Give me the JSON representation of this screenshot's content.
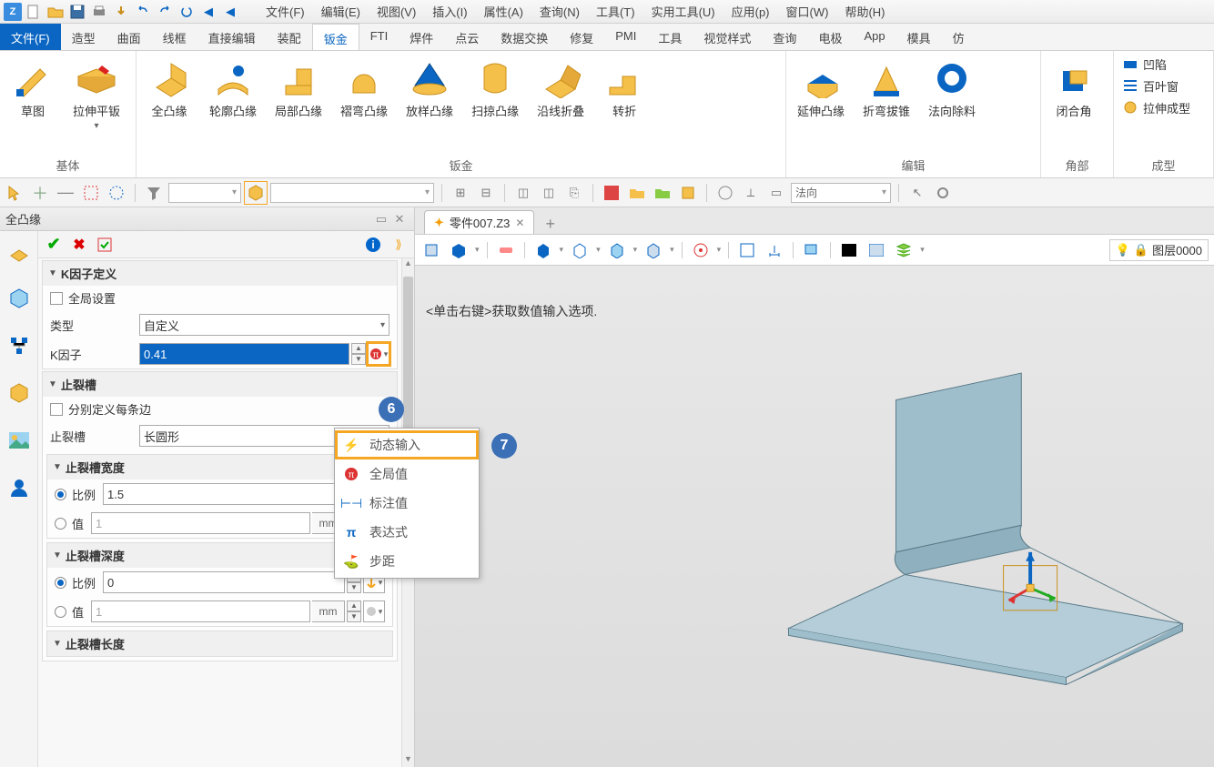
{
  "menus": {
    "file": "文件(F)",
    "edit": "编辑(E)",
    "view": "视图(V)",
    "insert": "插入(I)",
    "attr": "属性(A)",
    "query": "查询(N)",
    "tool": "工具(T)",
    "util": "实用工具(U)",
    "app": "应用(p)",
    "window": "窗口(W)",
    "help": "帮助(H)"
  },
  "ribbon_tabs": {
    "file": "文件(F)",
    "shape": "造型",
    "surface": "曲面",
    "wire": "线框",
    "direct": "直接编辑",
    "assembly": "装配",
    "sheet": "钣金",
    "fti": "FTI",
    "weld": "焊件",
    "pointcloud": "点云",
    "exchange": "数据交换",
    "heal": "修复",
    "pmi": "PMI",
    "tools": "工具",
    "visual": "视觉样式",
    "inquire": "查询",
    "electrode": "电极",
    "appt": "App",
    "mold": "模具",
    "more": "仿"
  },
  "ribbon": {
    "base": {
      "sketch": "草图",
      "tab": "拉伸平钣",
      "group": "基体"
    },
    "sheet": {
      "full": "全凸缘",
      "profile": "轮廓凸缘",
      "partial": "局部凸缘",
      "hem": "褶弯凸缘",
      "loft": "放样凸缘",
      "sweep": "扫掠凸缘",
      "bend": "沿线折叠",
      "jog": "转折",
      "group": "钣金"
    },
    "edit": {
      "extend": "延伸凸缘",
      "taper": "折弯拔锥",
      "normal": "法向除料",
      "group": "编辑"
    },
    "corner": {
      "close": "闭合角",
      "group": "角部"
    },
    "form": {
      "dimple": "凹陷",
      "louver": "百叶窗",
      "punch": "拉伸成型",
      "group": "成型"
    }
  },
  "toolstrip": {
    "direction": "法向"
  },
  "panel": {
    "title": "全凸缘",
    "kfactor_section": "K因子定义",
    "global_settings": "全局设置",
    "type_label": "类型",
    "type_value": "自定义",
    "k_label": "K因子",
    "k_value": "0.41",
    "relief_section": "止裂槽",
    "per_edge": "分别定义每条边",
    "relief_label": "止裂槽",
    "relief_value": "长圆形",
    "width_section": "止裂槽宽度",
    "ratio": "比例",
    "value": "值",
    "width_ratio": "1.5",
    "width_value": "1",
    "depth_section": "止裂槽深度",
    "depth_ratio": "0",
    "depth_value": "1",
    "length_section": "止裂槽长度",
    "unit": "mm"
  },
  "doc": {
    "tab": "零件007.Z3"
  },
  "canvas": {
    "hint": "<单击右键>获取数值输入选项.",
    "layer": "图层0000"
  },
  "popup": {
    "dynamic": "动态输入",
    "global": "全局值",
    "dim": "标注值",
    "expr": "表达式",
    "step": "步距"
  },
  "bubbles": {
    "six": "6",
    "seven": "7"
  }
}
